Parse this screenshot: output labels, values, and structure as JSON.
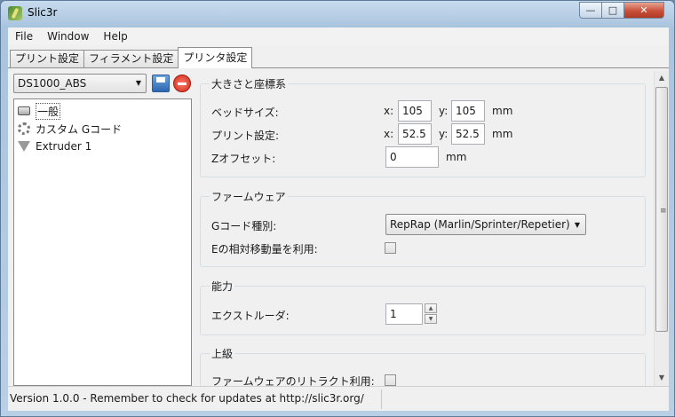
{
  "window": {
    "title": "Slic3r",
    "minimize": "—",
    "maximize": "□",
    "close": "✕"
  },
  "menu": [
    "File",
    "Window",
    "Help"
  ],
  "tabs": [
    "プリント設定",
    "フィラメント設定",
    "プリンタ設定"
  ],
  "active_tab": "プリンタ設定",
  "preset": {
    "selected": "DS1000_ABS",
    "arrow": "▼"
  },
  "tree": [
    {
      "label": "一般",
      "icon": "printer-icon"
    },
    {
      "label": "カスタム Gコード",
      "icon": "gear-icon"
    },
    {
      "label": "Extruder 1",
      "icon": "filter-icon"
    }
  ],
  "size_coords": {
    "title": "大きさと座標系",
    "bed_size": {
      "label": "ベッドサイズ:",
      "x_label": "x:",
      "x": "105",
      "y_label": "y:",
      "y": "105",
      "unit": "mm"
    },
    "print_center": {
      "label": "プリント設定:",
      "x_label": "x:",
      "x": "52.5",
      "y_label": "y:",
      "y": "52.5",
      "unit": "mm"
    },
    "z_offset": {
      "label": "Zオフセット:",
      "value": "0",
      "unit": "mm"
    }
  },
  "firmware": {
    "title": "ファームウェア",
    "gcode_flavor": {
      "label": "Gコード種別:",
      "value": "RepRap (Marlin/Sprinter/Repetier)",
      "arrow": "▼"
    },
    "relative_e": {
      "label": "Eの相対移動量を利用:",
      "checked": false
    }
  },
  "capabilities": {
    "title": "能力",
    "extruders": {
      "label": "エクストルーダ:",
      "value": "1",
      "up": "▲",
      "down": "▼"
    }
  },
  "advanced": {
    "title": "上級",
    "firmware_retract": {
      "label": "ファームウェアのリトラクト利用:",
      "checked": false
    }
  },
  "scrollbar": {
    "up": "▲",
    "down": "▼",
    "grip": "≡"
  },
  "status": "Version 1.0.0 - Remember to check for updates at http://slic3r.org/"
}
